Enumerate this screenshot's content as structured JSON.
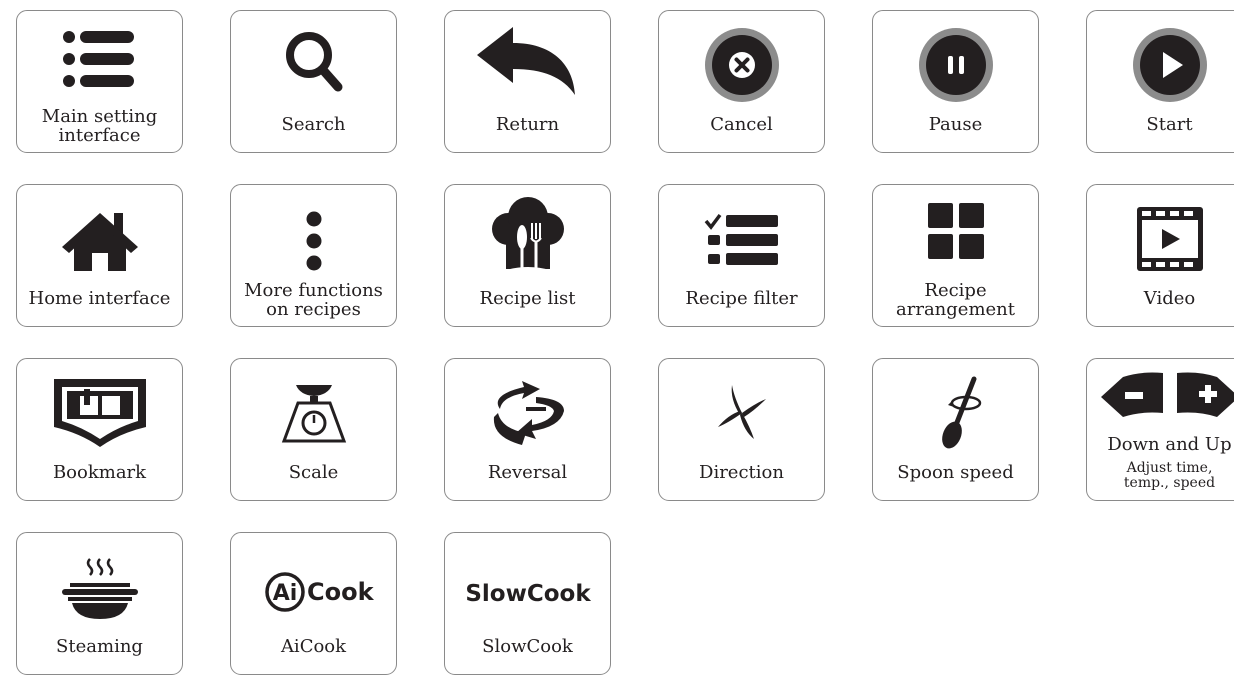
{
  "colors": {
    "icon": "#231f20",
    "border": "#8a8a8a",
    "ring": "#8c8c8c"
  },
  "cards": [
    {
      "label1": "Main setting",
      "label2": "interface",
      "icon": "menu-list-icon"
    },
    {
      "label1": "Search",
      "icon": "search-icon"
    },
    {
      "label1": "Return",
      "icon": "return-arrow-icon"
    },
    {
      "label1": "Cancel",
      "icon": "cancel-x-icon"
    },
    {
      "label1": "Pause",
      "icon": "pause-icon"
    },
    {
      "label1": "Start",
      "icon": "play-icon"
    },
    {
      "label1": "Home interface",
      "icon": "home-icon"
    },
    {
      "label1": "More functions",
      "label2": "on recipes",
      "icon": "vertical-dots-icon"
    },
    {
      "label1": "Recipe list",
      "icon": "chef-hat-cutlery-icon"
    },
    {
      "label1": "Recipe filter",
      "icon": "checklist-filter-icon"
    },
    {
      "label1": "Recipe",
      "label2": "arrangement",
      "icon": "grid-icon"
    },
    {
      "label1": "Video",
      "icon": "film-play-icon"
    },
    {
      "label1": "Bookmark",
      "icon": "bookmark-book-icon"
    },
    {
      "label1": "Scale",
      "icon": "kitchen-scale-icon"
    },
    {
      "label1": "Reversal",
      "icon": "reverse-arrows-icon"
    },
    {
      "label1": "Direction",
      "icon": "blade-direction-icon"
    },
    {
      "label1": "Spoon speed",
      "icon": "spoon-speed-icon"
    },
    {
      "label1": "Down and Up",
      "sub1": "Adjust time,",
      "sub2": "temp., speed",
      "icon": "minus-plus-icon"
    },
    {
      "label1": "Steaming",
      "icon": "steaming-pot-icon"
    },
    {
      "label1": "AiCook",
      "icon": "aicook-logo-icon",
      "logo": "AiCook"
    },
    {
      "label1": "SlowCook",
      "icon": "slowcook-logo-icon",
      "logo": "SlowCook"
    }
  ]
}
